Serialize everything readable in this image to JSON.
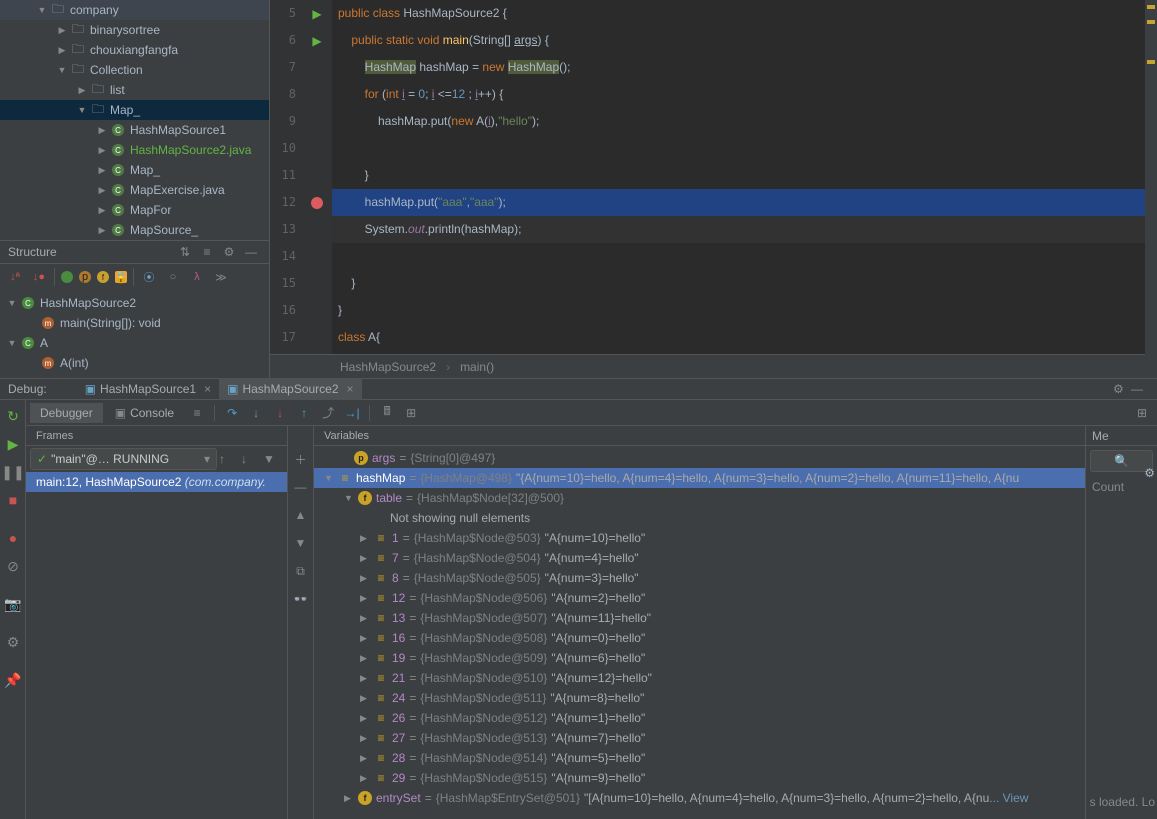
{
  "project_tree": [
    {
      "arrow": "▼",
      "icon": "folder",
      "label": "company",
      "indent": 36
    },
    {
      "arrow": "▶",
      "icon": "folder",
      "label": "binarysortree",
      "indent": 56
    },
    {
      "arrow": "▶",
      "icon": "folder",
      "label": "chouxiangfangfa",
      "indent": 56
    },
    {
      "arrow": "▼",
      "icon": "folder",
      "label": "Collection",
      "indent": 56
    },
    {
      "arrow": "▶",
      "icon": "folder",
      "label": "list",
      "indent": 76
    },
    {
      "arrow": "▼",
      "icon": "folder",
      "label": "Map_",
      "indent": 76,
      "selected": true
    },
    {
      "arrow": "▶",
      "icon": "java",
      "label": "HashMapSource1",
      "indent": 96
    },
    {
      "arrow": "▶",
      "icon": "java",
      "label": "HashMapSource2.java",
      "indent": 96,
      "active": true
    },
    {
      "arrow": "▶",
      "icon": "java",
      "label": "Map_",
      "indent": 96
    },
    {
      "arrow": "▶",
      "icon": "java",
      "label": "MapExercise.java",
      "indent": 96
    },
    {
      "arrow": "▶",
      "icon": "java",
      "label": "MapFor",
      "indent": 96
    },
    {
      "arrow": "▶",
      "icon": "java",
      "label": "MapSource_",
      "indent": 96
    }
  ],
  "structure": {
    "title": "Structure",
    "items": [
      {
        "arrow": "▼",
        "icon": "class",
        "label": "HashMapSource2",
        "indent": 6
      },
      {
        "arrow": "",
        "icon": "method",
        "label": "main(String[]): void",
        "indent": 26
      },
      {
        "arrow": "▼",
        "icon": "class",
        "label": "A",
        "indent": 6
      },
      {
        "arrow": "",
        "icon": "method",
        "label": "A(int)",
        "indent": 26
      }
    ]
  },
  "editor": {
    "lines_start": 5,
    "breakpoint_line": 12,
    "run_lines": [
      5,
      6
    ],
    "fold_lines": [
      5,
      6,
      12
    ],
    "breadcrumb": [
      "HashMapSource2",
      "main()"
    ]
  },
  "debug": {
    "label": "Debug:",
    "tabs": [
      {
        "label": "HashMapSource1"
      },
      {
        "label": "HashMapSource2",
        "active": true
      }
    ],
    "tool_tabs": [
      {
        "label": "Debugger",
        "active": true
      },
      {
        "label": "Console"
      }
    ],
    "frames": {
      "title": "Frames",
      "combo": "\"main\"@… RUNNING",
      "items": [
        {
          "label": "main:12, HashMapSource2 ",
          "gray": "(com.company.",
          "selected": true
        }
      ]
    },
    "variables": {
      "title": "Variables",
      "args": {
        "name": "args",
        "type": "{String[0]@497}"
      },
      "hashmap": {
        "name": "hashMap",
        "type": "{HashMap@498}",
        "val": "\"{A{num=10}=hello, A{num=4}=hello, A{num=3}=hello, A{num=2}=hello, A{num=11}=hello, A{nu"
      },
      "table": {
        "name": "table",
        "type": "{HashMap$Node[32]@500}"
      },
      "notshowing": "Not showing null elements",
      "entries": [
        {
          "idx": "1",
          "type": "{HashMap$Node@503}",
          "val": "\"A{num=10}=hello\""
        },
        {
          "idx": "7",
          "type": "{HashMap$Node@504}",
          "val": "\"A{num=4}=hello\""
        },
        {
          "idx": "8",
          "type": "{HashMap$Node@505}",
          "val": "\"A{num=3}=hello\""
        },
        {
          "idx": "12",
          "type": "{HashMap$Node@506}",
          "val": "\"A{num=2}=hello\""
        },
        {
          "idx": "13",
          "type": "{HashMap$Node@507}",
          "val": "\"A{num=11}=hello\""
        },
        {
          "idx": "16",
          "type": "{HashMap$Node@508}",
          "val": "\"A{num=0}=hello\""
        },
        {
          "idx": "19",
          "type": "{HashMap$Node@509}",
          "val": "\"A{num=6}=hello\""
        },
        {
          "idx": "21",
          "type": "{HashMap$Node@510}",
          "val": "\"A{num=12}=hello\""
        },
        {
          "idx": "24",
          "type": "{HashMap$Node@511}",
          "val": "\"A{num=8}=hello\""
        },
        {
          "idx": "26",
          "type": "{HashMap$Node@512}",
          "val": "\"A{num=1}=hello\""
        },
        {
          "idx": "27",
          "type": "{HashMap$Node@513}",
          "val": "\"A{num=7}=hello\""
        },
        {
          "idx": "28",
          "type": "{HashMap$Node@514}",
          "val": "\"A{num=5}=hello\""
        },
        {
          "idx": "29",
          "type": "{HashMap$Node@515}",
          "val": "\"A{num=9}=hello\""
        }
      ],
      "entrySet": {
        "name": "entrySet",
        "type": "{HashMap$EntrySet@501}",
        "val": "\"[A{num=10}=hello, A{num=4}=hello, A{num=3}=hello, A{num=2}=hello, A{nu",
        "view": "... View"
      }
    },
    "right": {
      "header": "Me",
      "col": "Count",
      "loaded": "s loaded. Lo"
    }
  }
}
